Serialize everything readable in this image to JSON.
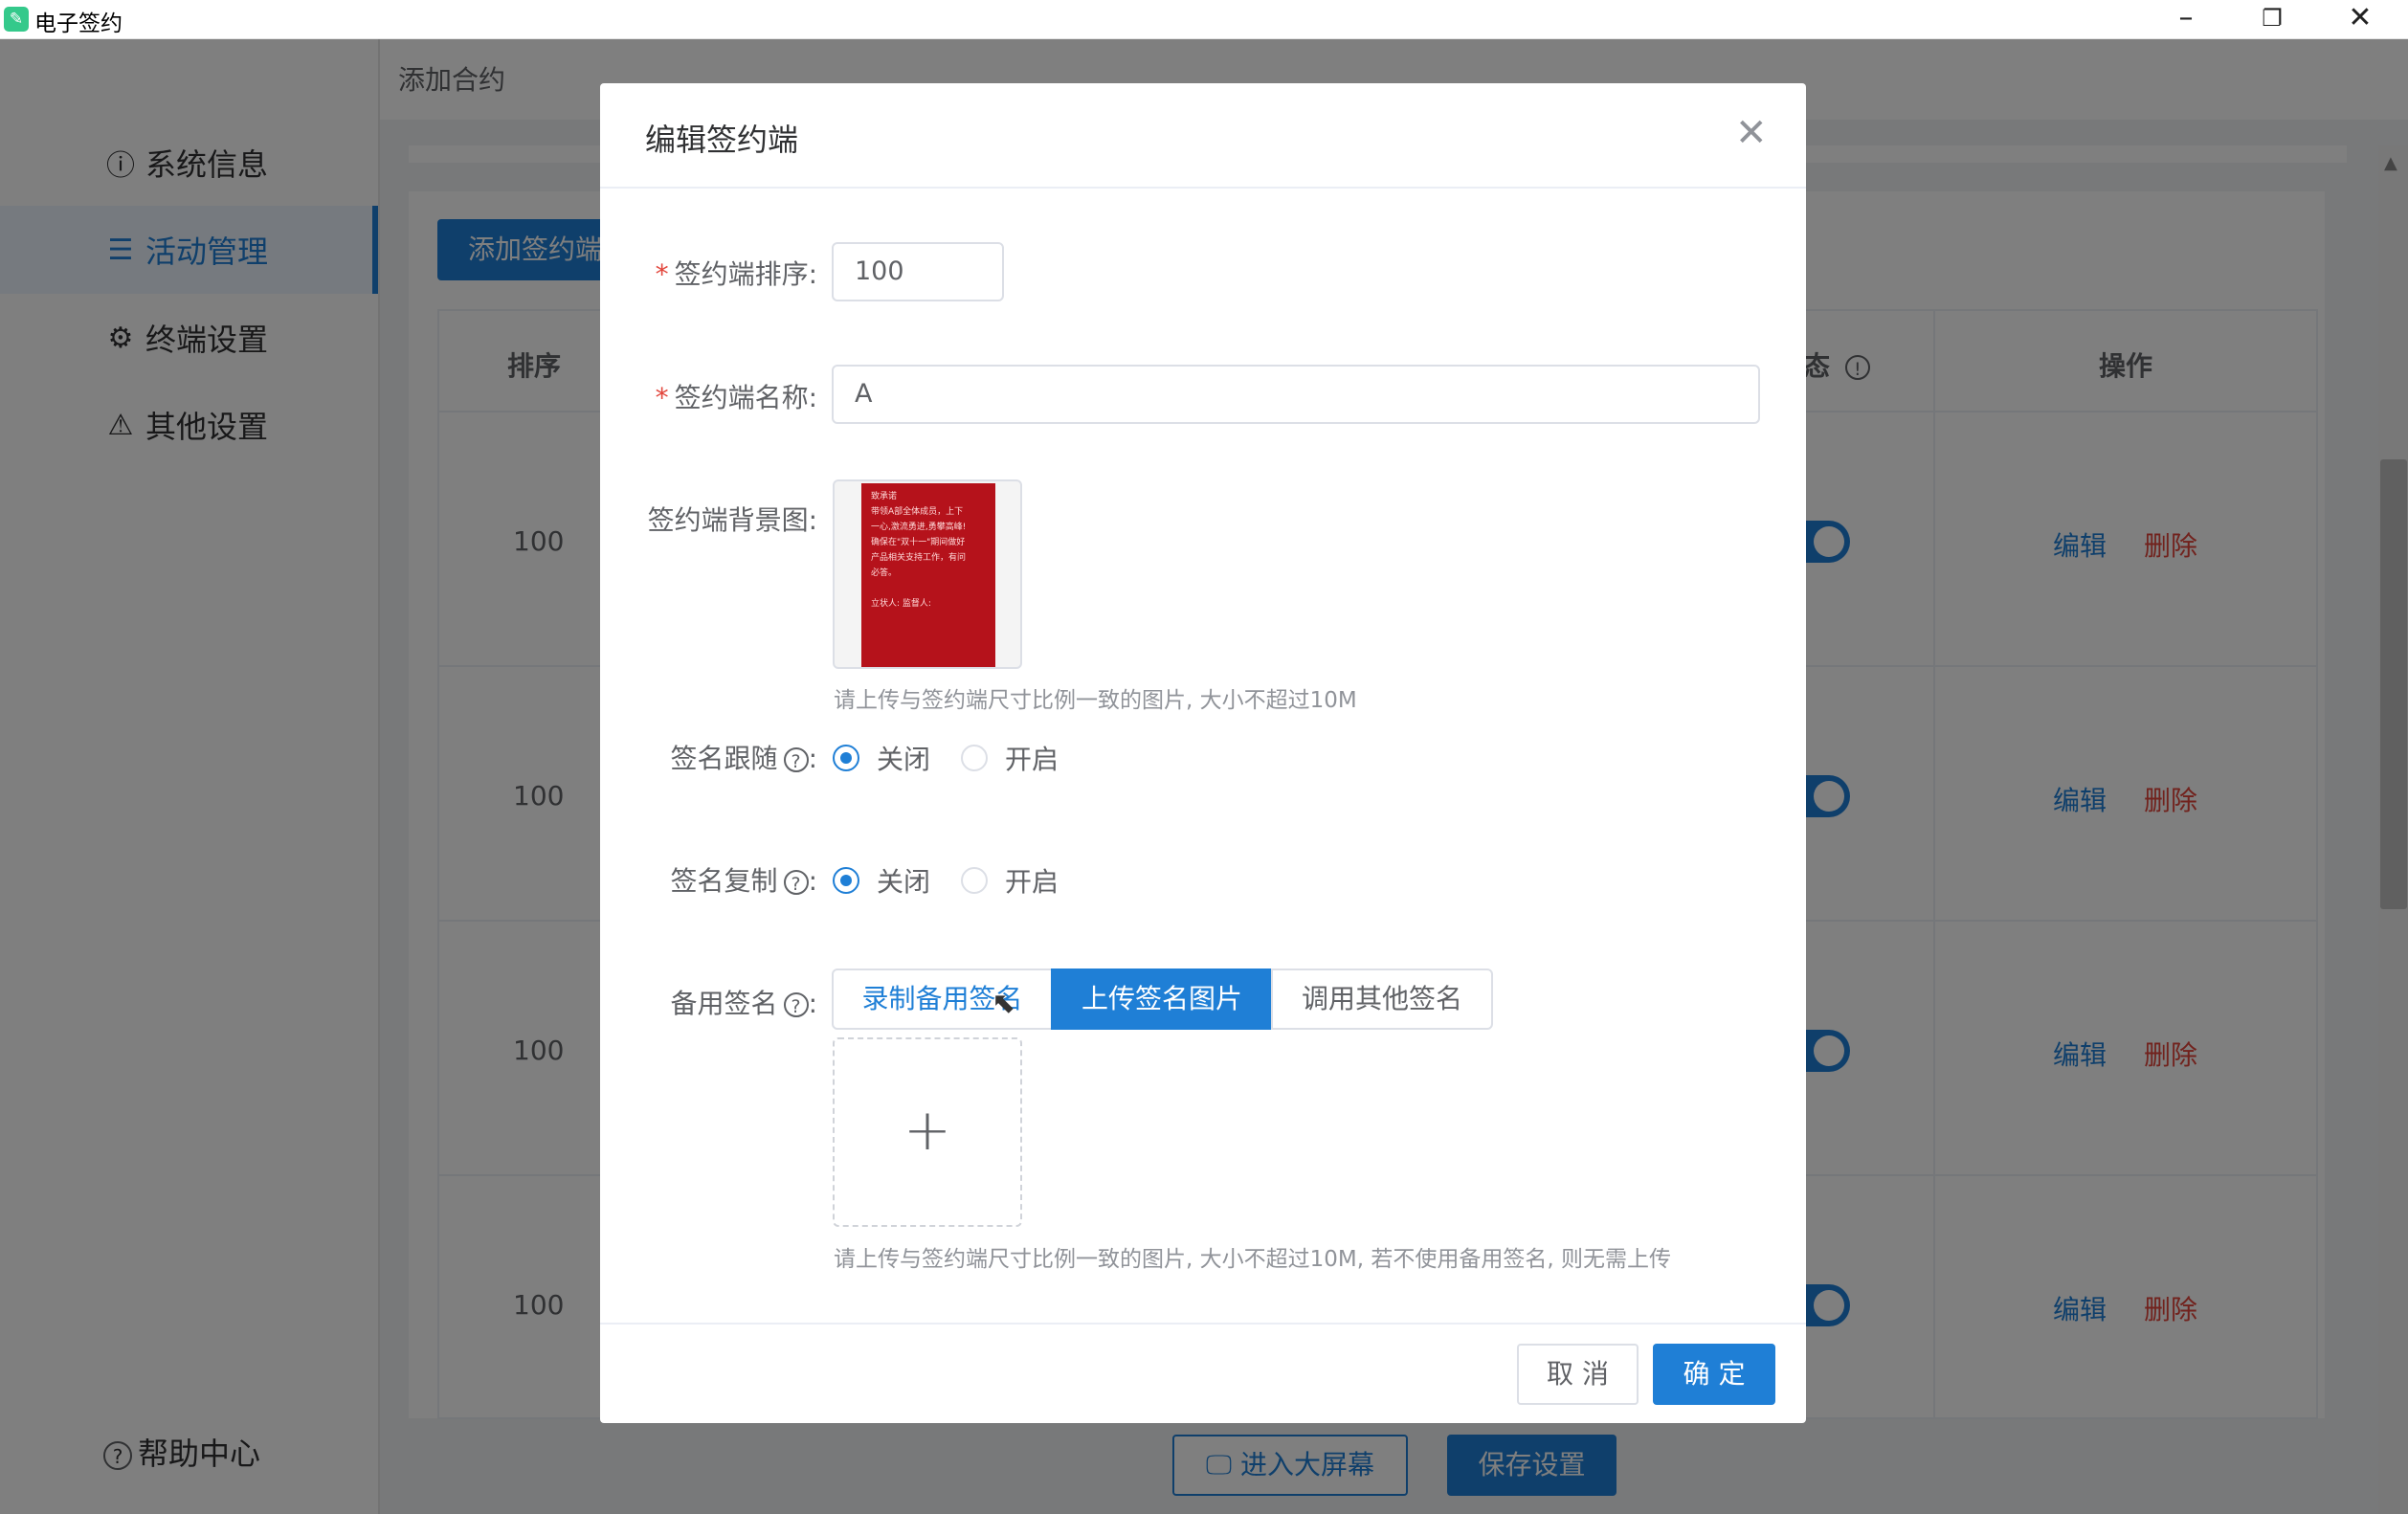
{
  "window": {
    "title": "电子签约",
    "icon": "app-icon",
    "controls": [
      "minimize-icon",
      "restore-icon",
      "close-icon"
    ]
  },
  "sidebar": {
    "items": [
      {
        "label": "系统信息",
        "icon": "info-icon",
        "glyph": "ⓘ"
      },
      {
        "label": "活动管理",
        "icon": "list-icon",
        "glyph": "☰",
        "active": true
      },
      {
        "label": "终端设置",
        "icon": "gear-icon",
        "glyph": "⚙"
      },
      {
        "label": "其他设置",
        "icon": "warning-icon",
        "glyph": "⚠"
      }
    ],
    "help": {
      "label": "帮助中心",
      "glyph": "?"
    }
  },
  "main": {
    "title": "添加合约",
    "add_button": "添加签约端",
    "table": {
      "headers": {
        "order": "排序",
        "status_partial": "态",
        "actions": "操作"
      },
      "rows": [
        {
          "order": "100",
          "edit": "编辑",
          "delete": "删除"
        },
        {
          "order": "100",
          "edit": "编辑",
          "delete": "删除"
        },
        {
          "order": "100",
          "edit": "编辑",
          "delete": "删除"
        },
        {
          "order": "100",
          "edit": "编辑",
          "delete": "删除"
        }
      ]
    },
    "screen_button": "进入大屏幕",
    "save_button": "保存设置"
  },
  "dialog": {
    "title": "编辑签约端",
    "order_label": "签约端排序:",
    "order_value": "100",
    "name_label": "签约端名称:",
    "name_value": "A",
    "bg_label": "签约端背景图:",
    "bg_preview_lines": [
      "致承诺",
      "带领A部全体成员，上下",
      "一心,激流勇进,勇攀高峰!",
      "确保在\"双十一\"期间做好",
      "产品相关支持工作，有问",
      "必答。",
      "",
      "立状人:        监督人:"
    ],
    "bg_hint": "请上传与签约端尺寸比例一致的图片, 大小不超过10M",
    "follow_label": "签名跟随",
    "copy_label": "签名复制",
    "radio_off": "关闭",
    "radio_on": "开启",
    "backup_label": "备用签名",
    "backup_tabs": [
      "录制备用签名",
      "上传签名图片",
      "调用其他签名"
    ],
    "backup_active": 1,
    "upload_hint": "请上传与签约端尺寸比例一致的图片, 大小不超过10M, 若不使用备用签名, 则无需上传",
    "cancel": "取 消",
    "ok": "确 定"
  },
  "colors": {
    "primary": "#1f7fd6",
    "danger": "#e2453b",
    "required": "#e2453b"
  }
}
